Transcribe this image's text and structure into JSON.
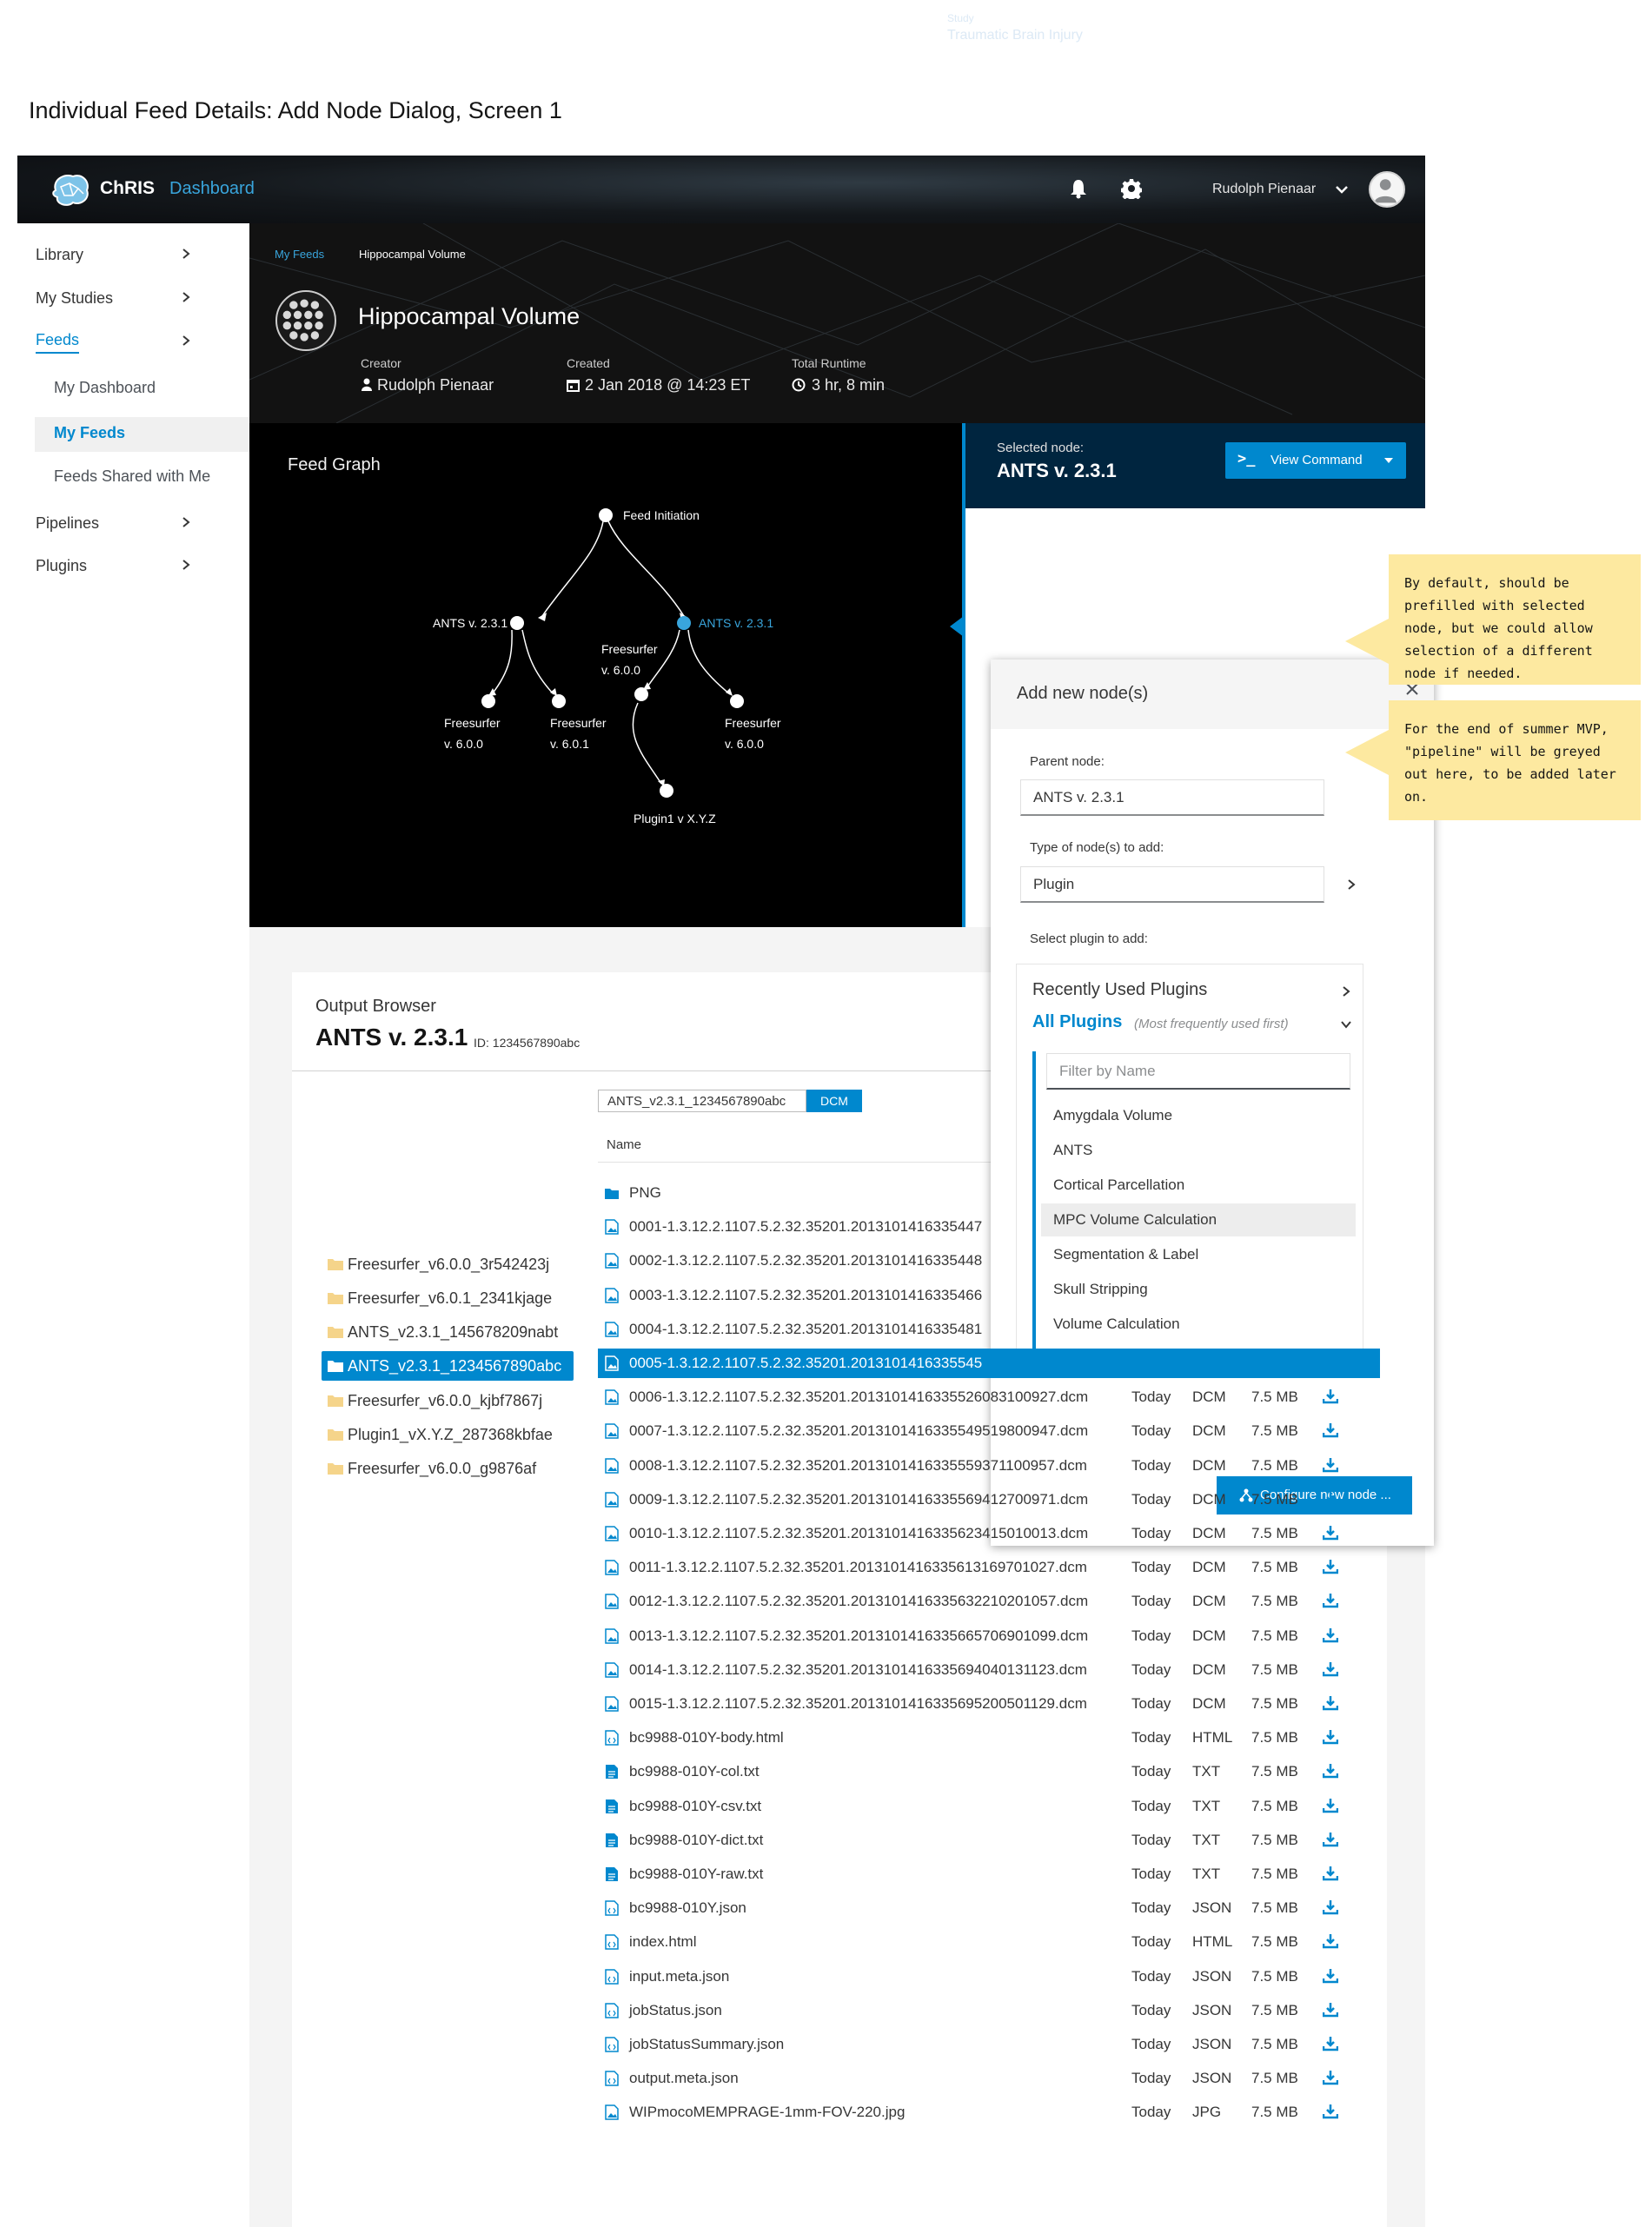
{
  "faint_header": {
    "study_label": "Study",
    "study_value": "Traumatic Brain Injury"
  },
  "page_heading": "Individual Feed Details: Add Node Dialog, Screen 1",
  "navbar": {
    "brand": "ChRIS",
    "brand_sub": "Dashboard",
    "user_name": "Rudolph Pienaar",
    "icons": [
      "bell-icon",
      "gear-icon",
      "chevron-down-icon",
      "avatar"
    ]
  },
  "sidebar": {
    "items": [
      {
        "label": "Library"
      },
      {
        "label": "My Studies"
      },
      {
        "label": "Feeds",
        "active": true
      },
      {
        "label": "Pipelines"
      },
      {
        "label": "Plugins"
      }
    ],
    "sub_items": [
      {
        "label": "My Dashboard"
      },
      {
        "label": "My Feeds",
        "selected": true
      },
      {
        "label": "Feeds Shared with Me"
      }
    ]
  },
  "header": {
    "breadcrumb_link": "My Feeds",
    "breadcrumb_current": "Hippocampal Volume",
    "title": "Hippocampal Volume",
    "creator_label": "Creator",
    "creator_value": "Rudolph Pienaar",
    "created_label": "Created",
    "created_value": "2 Jan 2018 @ 14:23 ET",
    "runtime_label": "Total Runtime",
    "runtime_value": "3 hr, 8 min"
  },
  "graph": {
    "title": "Feed Graph",
    "nodes": [
      {
        "id": "root",
        "label": "Feed Initiation"
      },
      {
        "id": "a1",
        "label": "ANTS v. 2.3.1"
      },
      {
        "id": "a2",
        "label": "ANTS v. 2.3.1",
        "selected": true
      },
      {
        "id": "f1",
        "label": "Freesurfer v. 6.0.0"
      },
      {
        "id": "f2",
        "label": "Freesurfer v. 6.0.1"
      },
      {
        "id": "f3",
        "label": "Freesurfer v. 6.0.0"
      },
      {
        "id": "f4",
        "label": "Freesurfer v. 6.0.0"
      },
      {
        "id": "p1",
        "label": "Plugin1 v X.Y.Z"
      }
    ]
  },
  "selected_node": {
    "label": "Selected node:",
    "value": "ANTS v. 2.3.1",
    "command_button": "View Command"
  },
  "output": {
    "label": "Output Browser",
    "title": "ANTS v. 2.3.1",
    "id": "ID: 1234567890abc",
    "folders": [
      {
        "name": "Freesurfer_v6.0.0_3r542423j"
      },
      {
        "name": "Freesurfer_v6.0.1_2341kjage"
      },
      {
        "name": "ANTS_v2.3.1_145678209nabt"
      },
      {
        "name": "ANTS_v2.3.1_1234567890abc",
        "selected": true
      },
      {
        "name": "Freesurfer_v6.0.0_kjbf7867j"
      },
      {
        "name": "Plugin1_vX.Y.Z_287368kbfae"
      },
      {
        "name": "Freesurfer_v6.0.0_g9876af"
      }
    ],
    "path": "ANTS_v2.3.1_1234567890abc",
    "path_tag": "DCM",
    "name_header": "Name",
    "files": [
      {
        "name": "PNG",
        "date": "",
        "type": "",
        "size": "",
        "icon": "folder-icon"
      },
      {
        "name": "0001-1.3.12.2.1107.5.2.32.35201.2013101416335447",
        "date": "",
        "type": "",
        "size": "",
        "icon": "image-file-icon"
      },
      {
        "name": "0002-1.3.12.2.1107.5.2.32.35201.2013101416335448",
        "date": "",
        "type": "",
        "size": "",
        "icon": "image-file-icon"
      },
      {
        "name": "0003-1.3.12.2.1107.5.2.32.35201.2013101416335466",
        "date": "",
        "type": "",
        "size": "",
        "icon": "image-file-icon"
      },
      {
        "name": "0004-1.3.12.2.1107.5.2.32.35201.2013101416335481",
        "date": "",
        "type": "",
        "size": "",
        "icon": "image-file-icon"
      },
      {
        "name": "0005-1.3.12.2.1107.5.2.32.35201.2013101416335545",
        "date": "",
        "type": "",
        "size": "",
        "icon": "image-file-icon",
        "selected": true
      },
      {
        "name": "0006-1.3.12.2.1107.5.2.32.35201.2013101416335526083100927.dcm",
        "date": "Today",
        "type": "DCM",
        "size": "7.5 MB",
        "icon": "image-file-icon"
      },
      {
        "name": "0007-1.3.12.2.1107.5.2.32.35201.2013101416335549519800947.dcm",
        "date": "Today",
        "type": "DCM",
        "size": "7.5 MB",
        "icon": "image-file-icon"
      },
      {
        "name": "0008-1.3.12.2.1107.5.2.32.35201.2013101416335559371100957.dcm",
        "date": "Today",
        "type": "DCM",
        "size": "7.5 MB",
        "icon": "image-file-icon"
      },
      {
        "name": "0009-1.3.12.2.1107.5.2.32.35201.2013101416335569412700971.dcm",
        "date": "Today",
        "type": "DCM",
        "size": "7.5 MB",
        "icon": "image-file-icon"
      },
      {
        "name": "0010-1.3.12.2.1107.5.2.32.35201.2013101416335623415010013.dcm",
        "date": "Today",
        "type": "DCM",
        "size": "7.5 MB",
        "icon": "image-file-icon"
      },
      {
        "name": "0011-1.3.12.2.1107.5.2.32.35201.2013101416335613169701027.dcm",
        "date": "Today",
        "type": "DCM",
        "size": "7.5 MB",
        "icon": "image-file-icon"
      },
      {
        "name": "0012-1.3.12.2.1107.5.2.32.35201.2013101416335632210201057.dcm",
        "date": "Today",
        "type": "DCM",
        "size": "7.5 MB",
        "icon": "image-file-icon"
      },
      {
        "name": "0013-1.3.12.2.1107.5.2.32.35201.2013101416335665706901099.dcm",
        "date": "Today",
        "type": "DCM",
        "size": "7.5 MB",
        "icon": "image-file-icon"
      },
      {
        "name": "0014-1.3.12.2.1107.5.2.32.35201.2013101416335694040131123.dcm",
        "date": "Today",
        "type": "DCM",
        "size": "7.5 MB",
        "icon": "image-file-icon"
      },
      {
        "name": "0015-1.3.12.2.1107.5.2.32.35201.2013101416335695200501129.dcm",
        "date": "Today",
        "type": "DCM",
        "size": "7.5 MB",
        "icon": "image-file-icon"
      },
      {
        "name": "bc9988-010Y-body.html",
        "date": "Today",
        "type": "HTML",
        "size": "7.5 MB",
        "icon": "code-file-icon"
      },
      {
        "name": "bc9988-010Y-col.txt",
        "date": "Today",
        "type": "TXT",
        "size": "7.5 MB",
        "icon": "text-file-icon"
      },
      {
        "name": "bc9988-010Y-csv.txt",
        "date": "Today",
        "type": "TXT",
        "size": "7.5 MB",
        "icon": "text-file-icon"
      },
      {
        "name": "bc9988-010Y-dict.txt",
        "date": "Today",
        "type": "TXT",
        "size": "7.5 MB",
        "icon": "text-file-icon"
      },
      {
        "name": "bc9988-010Y-raw.txt",
        "date": "Today",
        "type": "TXT",
        "size": "7.5 MB",
        "icon": "text-file-icon"
      },
      {
        "name": "bc9988-010Y.json",
        "date": "Today",
        "type": "JSON",
        "size": "7.5 MB",
        "icon": "code-file-icon"
      },
      {
        "name": "index.html",
        "date": "Today",
        "type": "HTML",
        "size": "7.5 MB",
        "icon": "code-file-icon"
      },
      {
        "name": "input.meta.json",
        "date": "Today",
        "type": "JSON",
        "size": "7.5 MB",
        "icon": "code-file-icon"
      },
      {
        "name": "jobStatus.json",
        "date": "Today",
        "type": "JSON",
        "size": "7.5 MB",
        "icon": "code-file-icon"
      },
      {
        "name": "jobStatusSummary.json",
        "date": "Today",
        "type": "JSON",
        "size": "7.5 MB",
        "icon": "code-file-icon"
      },
      {
        "name": "output.meta.json",
        "date": "Today",
        "type": "JSON",
        "size": "7.5 MB",
        "icon": "code-file-icon"
      },
      {
        "name": "WIPmocoMEMPRAGE-1mm-FOV-220.jpg",
        "date": "Today",
        "type": "JPG",
        "size": "7.5 MB",
        "icon": "image-file-icon"
      }
    ]
  },
  "dialog": {
    "title": "Add new node(s)",
    "parent_label": "Parent node:",
    "parent_value": "ANTS v. 2.3.1",
    "type_label": "Type of node(s) to add:",
    "type_value": "Plugin",
    "select_label": "Select plugin to add:",
    "recent_label": "Recently Used Plugins",
    "all_label": "All Plugins",
    "all_hint": "(Most frequently used first)",
    "filter_placeholder": "Filter by Name",
    "plugins": [
      {
        "label": "Amygdala Volume"
      },
      {
        "label": "ANTS"
      },
      {
        "label": "Cortical Parcellation"
      },
      {
        "label": "MPC Volume Calculation",
        "hovered": true
      },
      {
        "label": "Segmentation & Label"
      },
      {
        "label": "Skull Stripping"
      },
      {
        "label": "Volume Calculation"
      }
    ],
    "configure_button": "Configure new node ..."
  },
  "notes": [
    {
      "text": "By default, should be prefilled with selected node, but we could allow selection of a different node if needed."
    },
    {
      "text": "For the end of summer MVP, \"pipeline\" will be greyed out here, to be added later on."
    }
  ],
  "colors": {
    "accent": "#0088ce",
    "dark_bg": "#000000",
    "note": "#fde9a0"
  }
}
